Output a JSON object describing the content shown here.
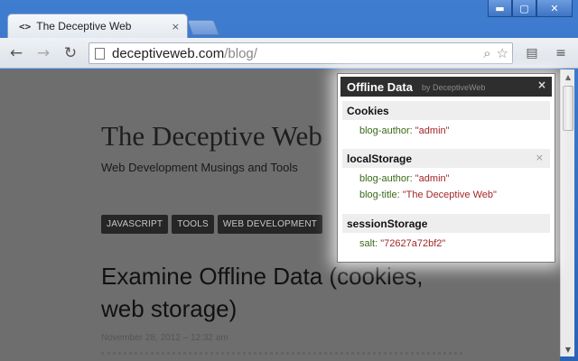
{
  "window": {
    "min_label": "▬",
    "max_label": "▢",
    "close_label": "✕"
  },
  "tab": {
    "icon": "<>",
    "title": "The Deceptive Web",
    "close": "×"
  },
  "toolbar": {
    "back": "←",
    "forward": "→",
    "reload": "↻",
    "url_host": "deceptiveweb.com",
    "url_path": "/blog/",
    "search_glyph": "⌕",
    "star_glyph": "☆",
    "ext_glyph": "▤",
    "menu_glyph": "≡"
  },
  "page": {
    "site_title": "The Deceptive Web",
    "tagline": "Web Development Musings and Tools",
    "tags": [
      "JAVASCRIPT",
      "TOOLS",
      "WEB DEVELOPMENT"
    ],
    "post_title": "Examine Offline Data (cookies, web storage)",
    "post_date": "November 28, 2012 – 12:32 am"
  },
  "scrollbar": {
    "up": "▲",
    "down": "▼"
  },
  "popup": {
    "title": "Offline Data",
    "byline": "by DeceptiveWeb",
    "close": "×",
    "sections": [
      {
        "name": "Cookies",
        "items": [
          {
            "key": "blog-author:",
            "value": "\"admin\""
          }
        ]
      },
      {
        "name": "localStorage",
        "close": "×",
        "items": [
          {
            "key": "blog-author:",
            "value": "\"admin\""
          },
          {
            "key": "blog-title:",
            "value": "\"The Deceptive Web\""
          }
        ]
      },
      {
        "name": "sessionStorage",
        "items": [
          {
            "key": "salt:",
            "value": "\"72627a72bf2\""
          }
        ]
      }
    ]
  }
}
